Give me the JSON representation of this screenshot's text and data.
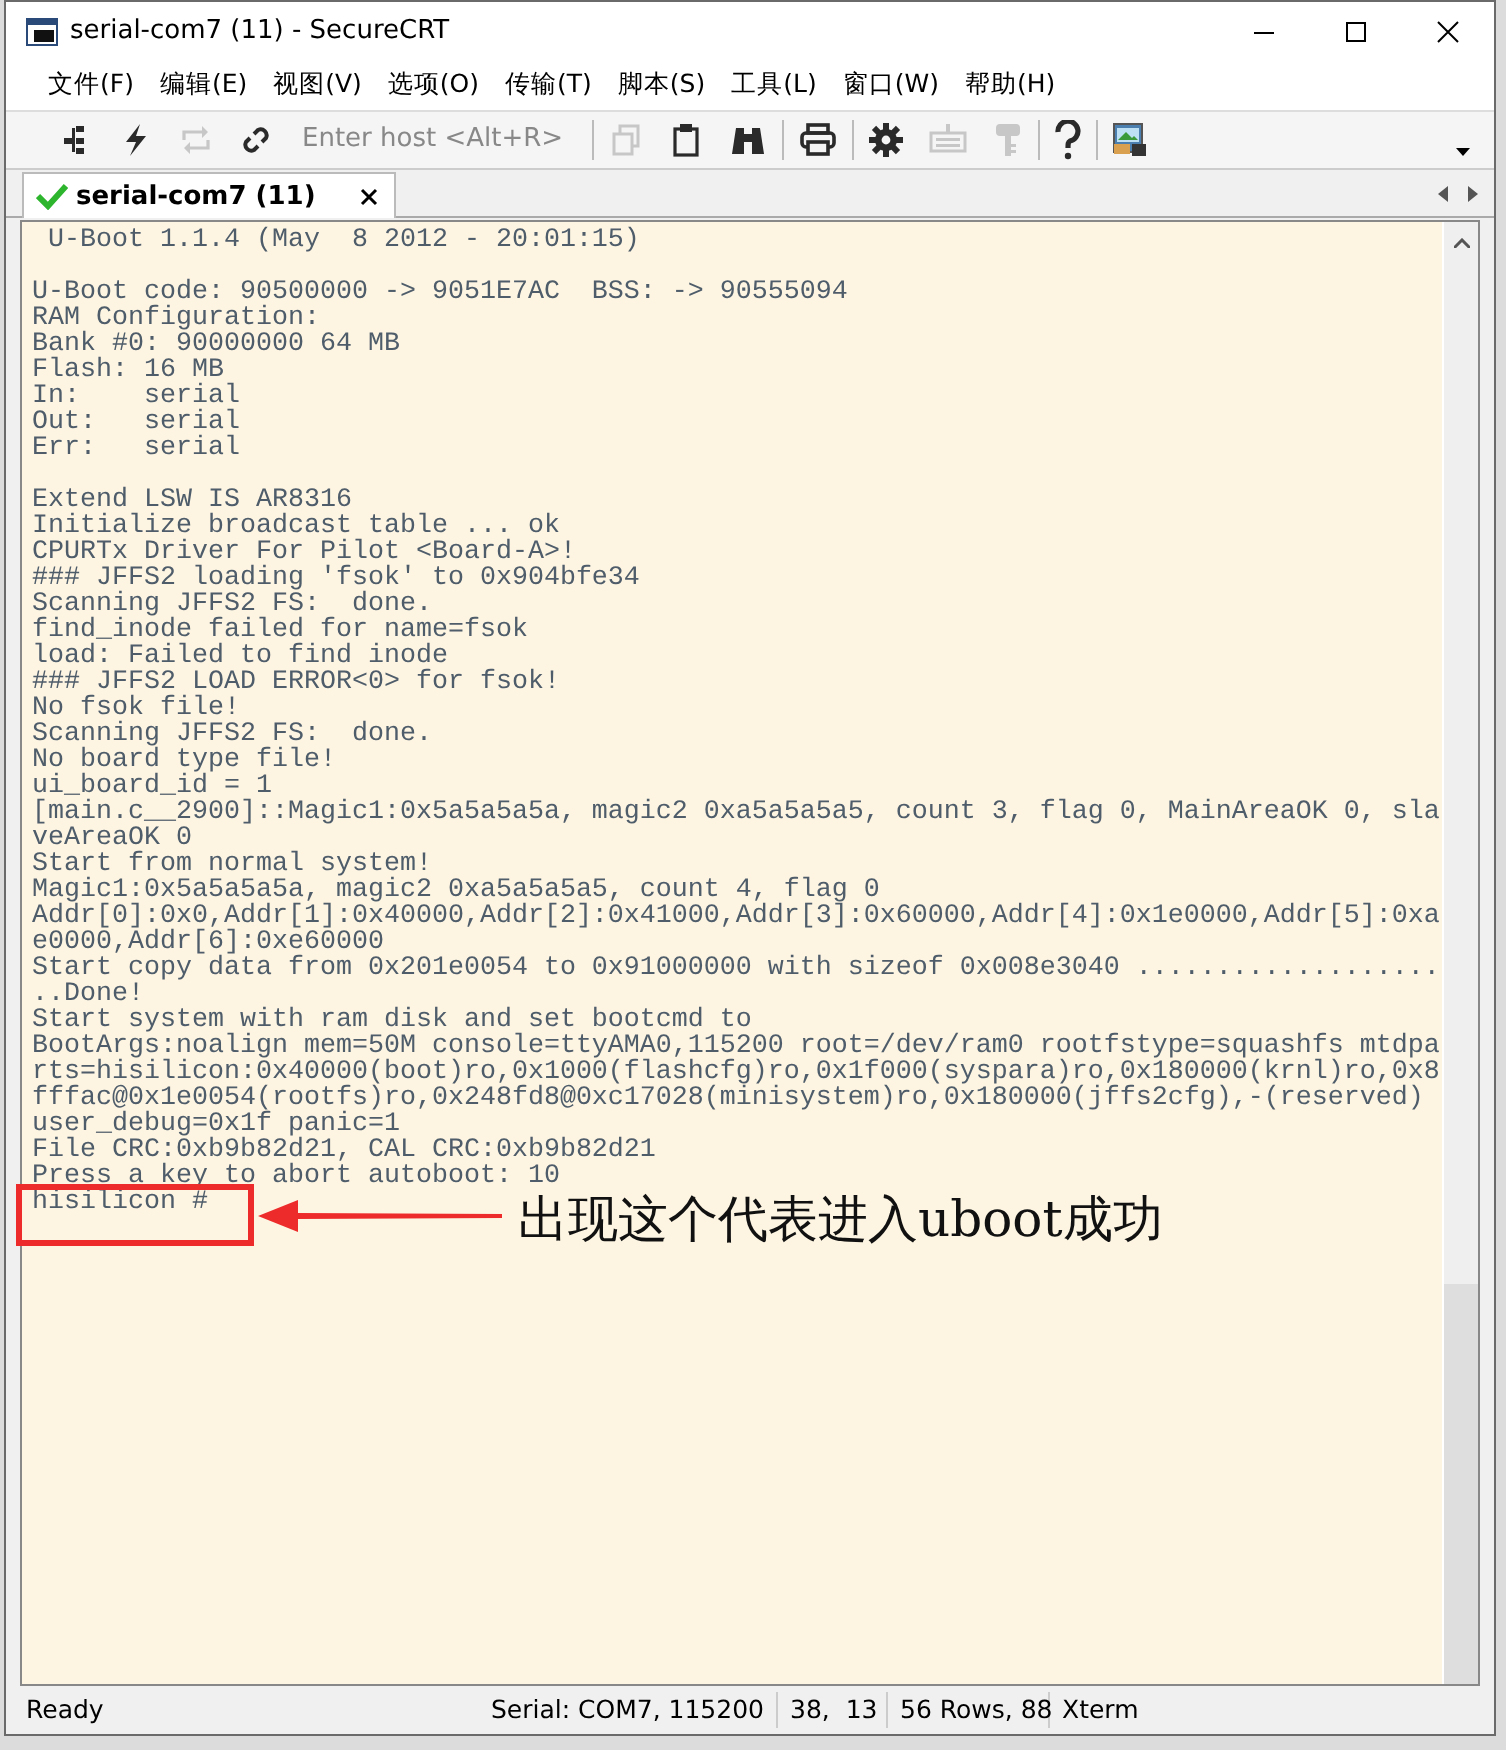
{
  "window": {
    "title": "serial-com7 (11) - SecureCRT"
  },
  "menu": [
    "文件(F)",
    "编辑(E)",
    "视图(V)",
    "选项(O)",
    "传输(T)",
    "脚本(S)",
    "工具(L)",
    "窗口(W)",
    "帮助(H)"
  ],
  "toolbar": {
    "buttons": [
      {
        "disabled": false
      },
      {
        "disabled": false
      },
      {
        "disabled": true
      },
      {
        "disabled": false
      },
      {
        "disabled": true
      },
      {
        "disabled": false
      },
      {
        "disabled": false
      },
      {
        "disabled": false
      },
      {
        "disabled": false
      },
      {
        "disabled": true
      },
      {
        "disabled": true
      },
      {
        "disabled": false
      },
      {
        "disabled": false
      }
    ],
    "host_field": {
      "placeholder": "Enter host <Alt+R>"
    }
  },
  "tabs": [
    {
      "label": "serial-com7 (11)",
      "selected": true,
      "connected": true
    }
  ],
  "terminal": {
    "blocks": [
      [
        " U-Boot 1.1.4 (May  8 2012 - 20:01:15)"
      ],
      [
        "U-Boot code: 90500000 -> 9051E7AC  BSS: -> 90555094",
        "RAM Configuration:",
        "Bank #0: 90000000 64 MB",
        "Flash: 16 MB",
        "In:    serial",
        "Out:   serial",
        "Err:   serial"
      ],
      [
        "Extend LSW IS AR8316",
        "Initialize broadcast table ... ok",
        "CPURTx Driver For Pilot <Board-A>!",
        "### JFFS2 loading 'fsok' to 0x904bfe34",
        "Scanning JFFS2 FS:  done.",
        "find_inode failed for name=fsok",
        "load: Failed to find inode",
        "### JFFS2 LOAD ERROR<0> for fsok!",
        "No fsok file!",
        "Scanning JFFS2 FS:  done.",
        "No board type file!",
        "ui_board_id = 1",
        "[main.c__2900]::Magic1:0x5a5a5a5a, magic2 0xa5a5a5a5, count 3, flag 0, MainAreaOK 0, sla",
        "veAreaOK 0",
        "Start from normal system!",
        "Magic1:0x5a5a5a5a, magic2 0xa5a5a5a5, count 4, flag 0",
        "Addr[0]:0x0,Addr[1]:0x40000,Addr[2]:0x41000,Addr[3]:0x60000,Addr[4]:0x1e0000,Addr[5]:0xa",
        "e0000,Addr[6]:0xe60000",
        "Start copy data from 0x201e0054 to 0x91000000 with sizeof 0x008e3040 ...................",
        "..Done!",
        "Start system with ram disk and set bootcmd to",
        "BootArgs:noalign mem=50M console=ttyAMA0,115200 root=/dev/ram0 rootfstype=squashfs mtdpa",
        "rts=hisilicon:0x40000(boot)ro,0x1000(flashcfg)ro,0x1f000(syspara)ro,0x180000(krnl)ro,0x8",
        "fffac@0x1e0054(rootfs)ro,0x248fd8@0xc17028(minisystem)ro,0x180000(jffs2cfg),-(reserved)",
        "user_debug=0x1f panic=1",
        "File CRC:0xb9b82d21, CAL CRC:0xb9b82d21",
        "Press a key to abort autoboot: 10",
        "hisilicon #"
      ]
    ]
  },
  "annotation": {
    "text": "出现这个代表进入uboot成功"
  },
  "status_bar": {
    "fields": [
      "Ready",
      "Serial: COM7, 115200",
      "38,  13",
      "56 Rows, 88",
      "Xterm"
    ]
  }
}
